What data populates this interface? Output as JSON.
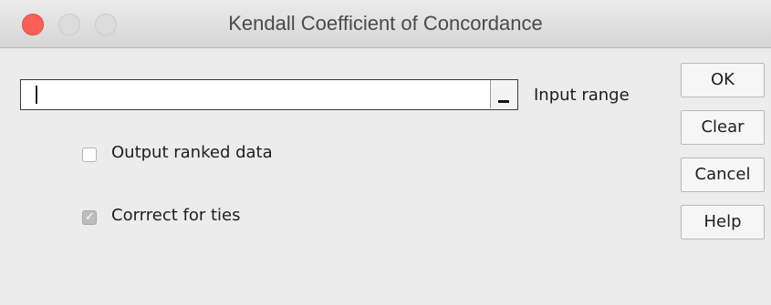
{
  "window": {
    "title": "Kendall Coefficient of Concordance"
  },
  "form": {
    "input_range": {
      "value": "",
      "label": "Input range"
    },
    "output_ranked_data": {
      "label": "Output ranked data",
      "checked": false
    },
    "correct_for_ties": {
      "label": "Corrrect for ties",
      "checked": true,
      "disabled": true
    }
  },
  "buttons": {
    "ok": "OK",
    "clear": "Clear",
    "cancel": "Cancel",
    "help": "Help"
  },
  "colors": {
    "close_light": "#fc5f57",
    "background": "#ececec"
  }
}
